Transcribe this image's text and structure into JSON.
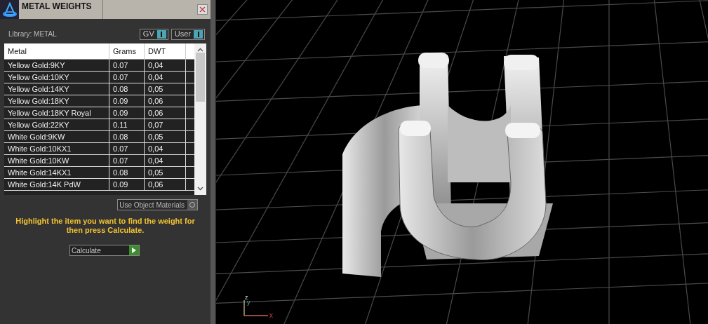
{
  "panel": {
    "title": "METAL WEIGHTS",
    "library_label": "Library: METAL",
    "toggles": [
      {
        "label": "GV",
        "on": true
      },
      {
        "label": "User",
        "on": true
      }
    ],
    "table": {
      "columns": [
        "Metal",
        "Grams",
        "DWT"
      ],
      "rows": [
        {
          "cells": [
            "Yellow Gold:9KY",
            "0.07",
            "0,04"
          ],
          "selected": false
        },
        {
          "cells": [
            "Yellow Gold:10KY",
            "0.07",
            "0,04"
          ],
          "selected": false
        },
        {
          "cells": [
            "Yellow Gold:14KY",
            "0.08",
            "0,05"
          ],
          "selected": false
        },
        {
          "cells": [
            "Yellow Gold:18KY",
            "0.09",
            "0,06"
          ],
          "selected": false
        },
        {
          "cells": [
            "Yellow Gold:18KY Royal",
            "0.09",
            "0,06"
          ],
          "selected": false
        },
        {
          "cells": [
            "Yellow Gold:22KY",
            "0.11",
            "0,07"
          ],
          "selected": false
        },
        {
          "cells": [
            "White Gold:9KW",
            "0.08",
            "0,05"
          ],
          "selected": false
        },
        {
          "cells": [
            "White Gold:10KX1",
            "0.07",
            "0,04"
          ],
          "selected": false
        },
        {
          "cells": [
            "White Gold:10KW",
            "0.07",
            "0,04"
          ],
          "selected": false
        },
        {
          "cells": [
            "White Gold:14KX1",
            "0.08",
            "0,05"
          ],
          "selected": false
        },
        {
          "cells": [
            "White Gold:14K PdW",
            "0.09",
            "0,06"
          ],
          "selected": false
        }
      ]
    },
    "use_object_materials": {
      "label": "Use Object Materials",
      "on": false
    },
    "hint": "Highlight the item you want to find the weight for then press Calculate.",
    "calculate_button": "Calculate"
  },
  "viewport": {
    "axes": [
      "z",
      "y",
      "x"
    ]
  }
}
